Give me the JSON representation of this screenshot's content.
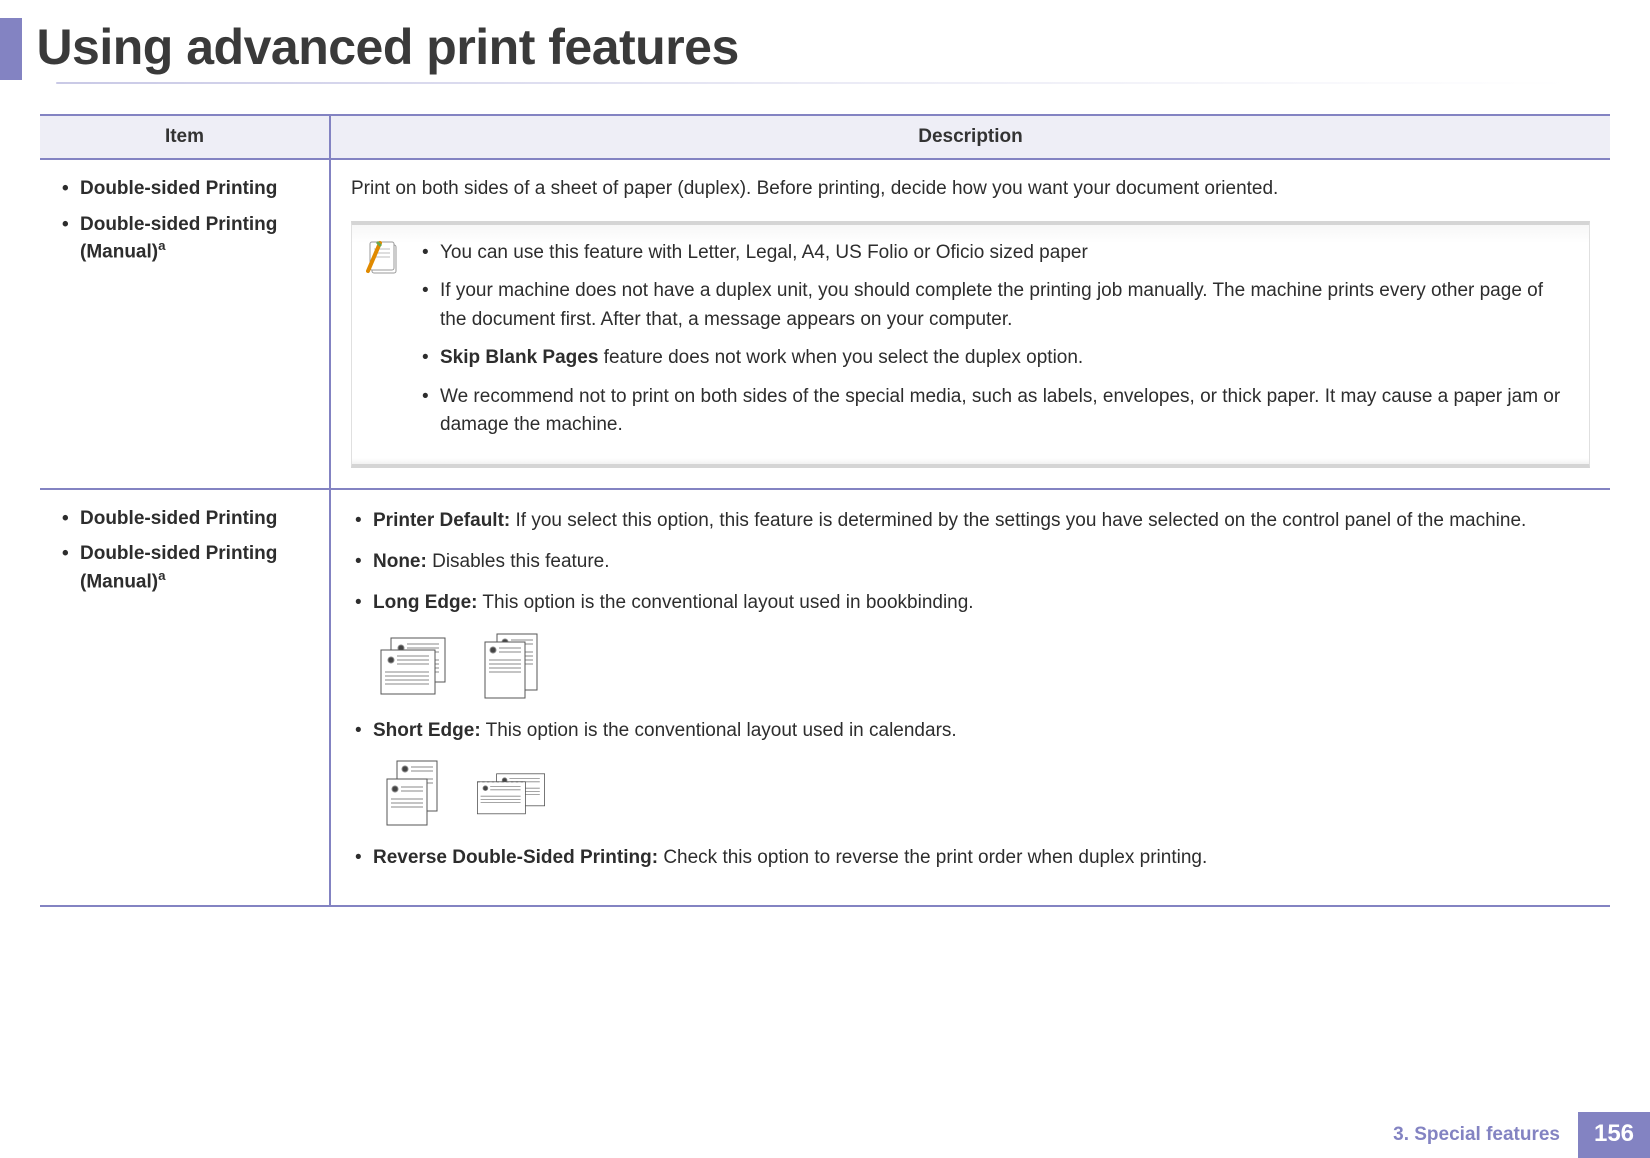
{
  "header": {
    "title": "Using advanced print features"
  },
  "table": {
    "col_item": "Item",
    "col_desc": "Description"
  },
  "row1": {
    "item_a": "Double-sided Printing",
    "item_b_pre": "Double-sided Printing (Manual)",
    "item_b_sup": "a",
    "lead": "Print on both sides of a sheet of paper (duplex). Before printing, decide how you want your document oriented.",
    "notes": {
      "n1": "You can use this feature with Letter, Legal, A4, US Folio or Oficio sized paper",
      "n2": "If your machine does not have a duplex unit, you should complete the printing job manually. The machine prints every other page of the document first. After that, a message appears on your computer.",
      "n3_bold": "Skip Blank Pages",
      "n3_rest": " feature does not work when you select the duplex option.",
      "n4": "We recommend not to print on both sides of the special media, such as labels, envelopes, or thick paper. It may cause a paper jam or damage the machine."
    }
  },
  "row2": {
    "item_a": "Double-sided Printing",
    "item_b_pre": "Double-sided Printing (Manual)",
    "item_b_sup": "a",
    "opts": {
      "o1_term": "Printer Default:",
      "o1_text": " If you select this option, this feature is determined by the settings you have selected on the control panel of the machine.",
      "o2_term": "None:",
      "o2_text": " Disables this feature.",
      "o3_term": "Long Edge:",
      "o3_text": " This option is the conventional layout used in bookbinding.",
      "o4_term": "Short Edge:",
      "o4_text": " This option is the conventional layout used in calendars.",
      "o5_term": "Reverse Double-Sided Printing:",
      "o5_text": " Check this option to reverse the print order when duplex printing."
    }
  },
  "footer": {
    "chapter": "3.  Special features",
    "page": "156"
  }
}
